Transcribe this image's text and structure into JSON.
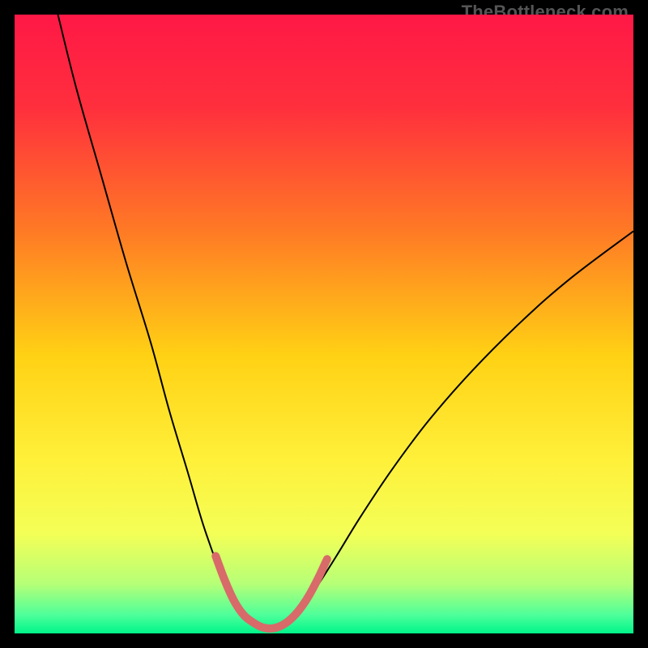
{
  "watermark": "TheBottleneck.com",
  "chart_data": {
    "type": "line",
    "title": "",
    "xlabel": "",
    "ylabel": "",
    "xlim": [
      0,
      100
    ],
    "ylim": [
      0,
      100
    ],
    "gradient_stops": [
      {
        "offset": 0.0,
        "color": "#ff1846"
      },
      {
        "offset": 0.15,
        "color": "#ff2f3d"
      },
      {
        "offset": 0.35,
        "color": "#ff7a25"
      },
      {
        "offset": 0.55,
        "color": "#ffd114"
      },
      {
        "offset": 0.72,
        "color": "#fff03a"
      },
      {
        "offset": 0.84,
        "color": "#f3ff57"
      },
      {
        "offset": 0.92,
        "color": "#b6ff77"
      },
      {
        "offset": 0.97,
        "color": "#4eff9a"
      },
      {
        "offset": 1.0,
        "color": "#00f58b"
      }
    ],
    "series": [
      {
        "name": "bottleneck-curve",
        "stroke": "#000000",
        "stroke_width": 2.0,
        "points": [
          {
            "x": 7.0,
            "y": 100.0
          },
          {
            "x": 10.0,
            "y": 88.0
          },
          {
            "x": 14.0,
            "y": 74.0
          },
          {
            "x": 18.0,
            "y": 60.0
          },
          {
            "x": 22.0,
            "y": 47.0
          },
          {
            "x": 25.0,
            "y": 36.0
          },
          {
            "x": 28.0,
            "y": 26.0
          },
          {
            "x": 30.5,
            "y": 17.5
          },
          {
            "x": 33.0,
            "y": 10.5
          },
          {
            "x": 35.0,
            "y": 6.0
          },
          {
            "x": 37.0,
            "y": 3.0
          },
          {
            "x": 39.0,
            "y": 1.5
          },
          {
            "x": 41.5,
            "y": 0.8
          },
          {
            "x": 44.0,
            "y": 1.5
          },
          {
            "x": 46.0,
            "y": 3.5
          },
          {
            "x": 48.5,
            "y": 7.0
          },
          {
            "x": 52.0,
            "y": 12.5
          },
          {
            "x": 56.0,
            "y": 19.0
          },
          {
            "x": 61.0,
            "y": 26.5
          },
          {
            "x": 67.0,
            "y": 34.5
          },
          {
            "x": 74.0,
            "y": 42.5
          },
          {
            "x": 82.0,
            "y": 50.5
          },
          {
            "x": 90.0,
            "y": 57.5
          },
          {
            "x": 100.0,
            "y": 65.0
          }
        ]
      },
      {
        "name": "highlight-valley",
        "stroke": "#d86a6a",
        "stroke_width": 10,
        "linecap": "round",
        "points": [
          {
            "x": 32.5,
            "y": 12.5
          },
          {
            "x": 34.0,
            "y": 8.5
          },
          {
            "x": 35.5,
            "y": 5.2
          },
          {
            "x": 37.0,
            "y": 3.0
          },
          {
            "x": 38.5,
            "y": 1.8
          },
          {
            "x": 40.0,
            "y": 1.0
          },
          {
            "x": 41.5,
            "y": 0.8
          },
          {
            "x": 43.0,
            "y": 1.2
          },
          {
            "x": 44.5,
            "y": 2.2
          },
          {
            "x": 46.0,
            "y": 3.8
          },
          {
            "x": 47.5,
            "y": 6.0
          },
          {
            "x": 49.0,
            "y": 8.8
          },
          {
            "x": 50.5,
            "y": 12.0
          }
        ]
      }
    ]
  }
}
